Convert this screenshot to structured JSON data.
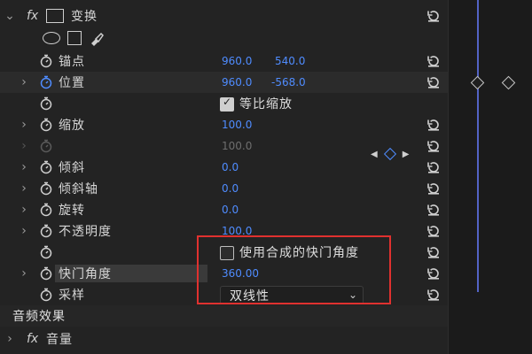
{
  "transform_header": {
    "fx": "fx",
    "label": "变换"
  },
  "rows": {
    "anchor": {
      "label": "锚点",
      "v1": "960.0",
      "v2": "540.0"
    },
    "position": {
      "label": "位置",
      "v1": "960.0",
      "v2": "-568.0"
    },
    "uniform_scale": {
      "label": "等比缩放",
      "checked": true
    },
    "scale": {
      "label": "缩放",
      "v1": "100.0"
    },
    "scale_width": {
      "v1": "100.0"
    },
    "skew": {
      "label": "倾斜",
      "v1": "0.0"
    },
    "skew_axis": {
      "label": "倾斜轴",
      "v1": "0.0"
    },
    "rotation": {
      "label": "旋转",
      "v1": "0.0"
    },
    "opacity": {
      "label": "不透明度",
      "v1": "100.0"
    },
    "use_comp_shutter": {
      "label": "使用合成的快门角度",
      "checked": false
    },
    "shutter_angle": {
      "label": "快门角度",
      "v1": "360.00"
    },
    "sampling": {
      "label": "采样",
      "value": "双线性"
    }
  },
  "audio_effects": {
    "label": "音频效果"
  },
  "volume": {
    "fx": "fx",
    "label": "音量"
  },
  "colors": {
    "accent": "#4f8cff",
    "highlight_box": "#e0312f"
  },
  "icons": [
    "chevron-right-icon",
    "stopwatch-icon",
    "reset-icon",
    "ellipse-mask-icon",
    "rect-mask-icon",
    "pen-mask-icon",
    "keyframe-diamond-icon"
  ]
}
